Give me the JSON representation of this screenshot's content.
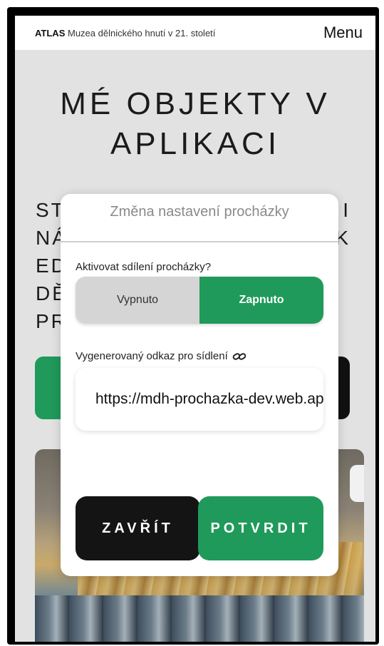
{
  "header": {
    "brand_bold": "ATLAS",
    "brand_sub": "Muzea dělnického hnutí v 21. století",
    "menu_label": "Menu"
  },
  "page": {
    "title_line1": "MÉ OBJEKTY V",
    "title_line2": "APLIKACI",
    "para_fragments": [
      {
        "left": "ST",
        "right": "I"
      },
      {
        "left": "NÁ",
        "right": "K"
      },
      {
        "left": "ED",
        "right": ""
      },
      {
        "left": "DĚ",
        "right": ""
      },
      {
        "left": "PR",
        "right": ""
      }
    ]
  },
  "modal": {
    "title": "Změna nastavení procházky",
    "share_label": "Aktivovat sdílení procházky?",
    "toggle": {
      "off_label": "Vypnuto",
      "on_label": "Zapnuto",
      "selected": "on"
    },
    "link_label": "Vygenerovaný odkaz pro sídlení",
    "link_value": "https://mdh-prochazka-dev.web.app",
    "close_label": "ZAVŘÍT",
    "confirm_label": "POTVRDIT"
  },
  "colors": {
    "accent": "#1f9a5a",
    "dark": "#141414",
    "background": "#e2e2e2"
  },
  "icons": {
    "link": "link-icon"
  }
}
